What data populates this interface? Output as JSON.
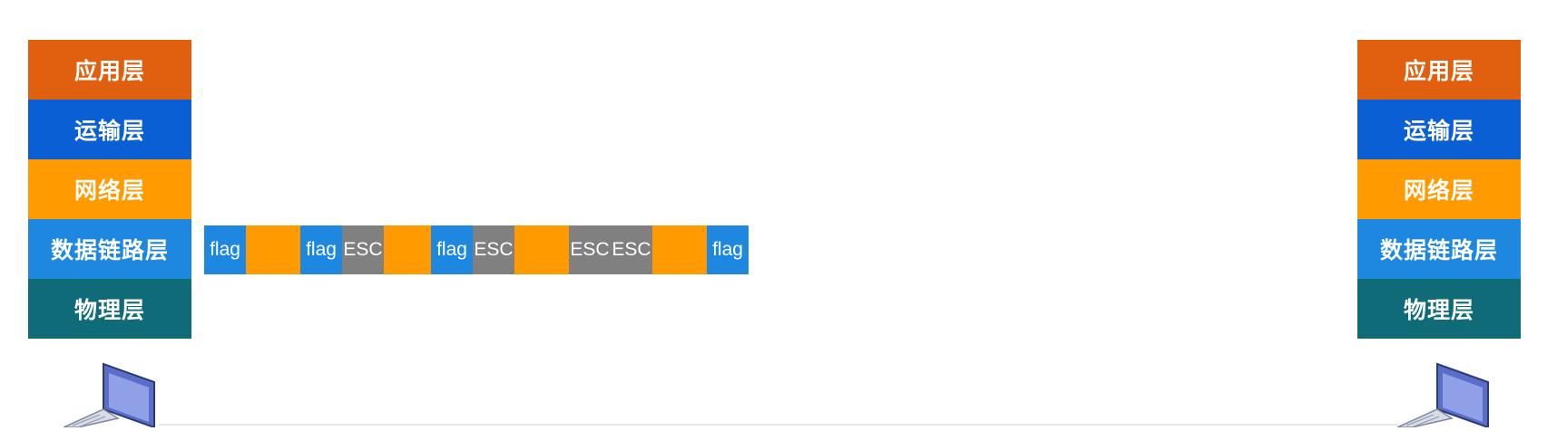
{
  "colors": {
    "application": "#e06010",
    "transport": "#0a5fd4",
    "network": "#ff9b00",
    "datalink": "#1e88e0",
    "physical": "#0f6b78",
    "flag": "#1e88e0",
    "esc": "#808080",
    "data": "#ff9b00"
  },
  "left_stack": {
    "layers": [
      {
        "label": "应用层",
        "color": "application"
      },
      {
        "label": "运输层",
        "color": "transport"
      },
      {
        "label": "网络层",
        "color": "network"
      },
      {
        "label": "数据链路层",
        "color": "datalink"
      },
      {
        "label": "物理层",
        "color": "physical"
      }
    ]
  },
  "right_stack": {
    "layers": [
      {
        "label": "应用层",
        "color": "application"
      },
      {
        "label": "运输层",
        "color": "transport"
      },
      {
        "label": "网络层",
        "color": "network"
      },
      {
        "label": "数据链路层",
        "color": "datalink"
      },
      {
        "label": "物理层",
        "color": "physical"
      }
    ]
  },
  "frame": {
    "cells": [
      {
        "type": "flag",
        "label": "flag"
      },
      {
        "type": "data",
        "label": ""
      },
      {
        "type": "flag",
        "label": "flag"
      },
      {
        "type": "esc",
        "label": "ESC"
      },
      {
        "type": "data",
        "label": ""
      },
      {
        "type": "flag",
        "label": "flag"
      },
      {
        "type": "esc",
        "label": "ESC"
      },
      {
        "type": "data",
        "label": ""
      },
      {
        "type": "esc",
        "label": "ESC"
      },
      {
        "type": "esc",
        "label": "ESC"
      },
      {
        "type": "data",
        "label": ""
      },
      {
        "type": "flag",
        "label": "flag"
      }
    ]
  },
  "icons": {
    "left_host": "laptop-icon",
    "right_host": "laptop-icon"
  }
}
